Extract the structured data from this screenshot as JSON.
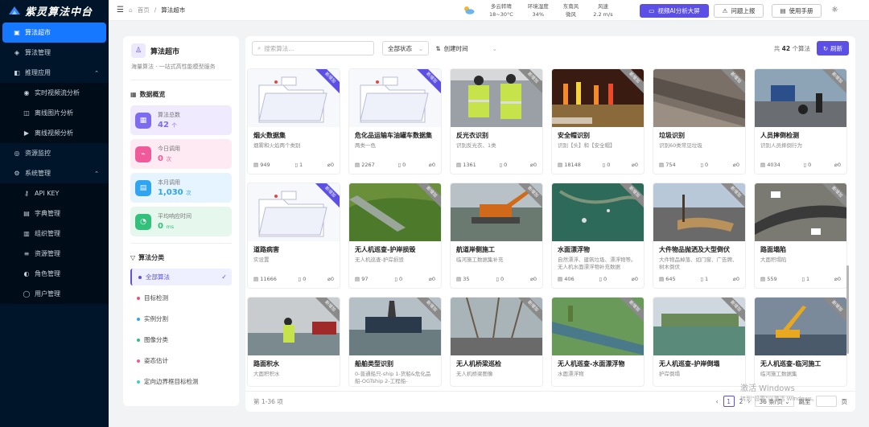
{
  "brand": {
    "name": "紫灵算法中台"
  },
  "sidebar": {
    "items": [
      {
        "label": "算法超市",
        "icon": "shop-icon",
        "active": true
      },
      {
        "label": "算法管理",
        "icon": "cube-icon"
      },
      {
        "label": "推理应用",
        "icon": "app-icon",
        "group": true
      },
      {
        "label": "实时视频流分析",
        "icon": "video-icon",
        "sub": true
      },
      {
        "label": "离线图片分析",
        "icon": "image-icon",
        "sub": true
      },
      {
        "label": "离线视频分析",
        "icon": "film-icon",
        "sub": true
      },
      {
        "label": "资源监控",
        "icon": "monitor-icon"
      },
      {
        "label": "系统管理",
        "icon": "gear-icon",
        "group": true
      },
      {
        "label": "API KEY",
        "icon": "key-icon",
        "sub": true
      },
      {
        "label": "字典管理",
        "icon": "book-icon",
        "sub": true
      },
      {
        "label": "组织管理",
        "icon": "org-icon",
        "sub": true
      },
      {
        "label": "资源管理",
        "icon": "list-icon",
        "sub": true
      },
      {
        "label": "角色管理",
        "icon": "role-icon",
        "sub": true
      },
      {
        "label": "用户管理",
        "icon": "user-icon",
        "sub": true
      }
    ]
  },
  "topbar": {
    "breadcrumb": {
      "home": "首页",
      "sep": "/",
      "current": "算法超市"
    },
    "weather": [
      {
        "l1": "多云转晴",
        "l2": "18~30°C"
      },
      {
        "l1": "环境湿度",
        "l2": "34%"
      },
      {
        "l1": "东南风",
        "l2": "微风"
      },
      {
        "l1": "风速",
        "l2": "2.2 m/s"
      }
    ],
    "big_screen_btn": "视频AI分析大屏",
    "report_btn": "问题上报",
    "manual_btn": "使用手册"
  },
  "left_panel": {
    "title": "算法超市",
    "subtitle": "海量算法 · 一站式高性能模型服务",
    "overview_title": "数据概览",
    "stats": [
      {
        "label": "算法总数",
        "value": "42",
        "unit": "个",
        "color": "#7d6cf0",
        "bg": "#efeafe"
      },
      {
        "label": "今日调用",
        "value": "0",
        "unit": "次",
        "color": "#f05a9a",
        "bg": "#fdeaf3"
      },
      {
        "label": "本月调用",
        "value": "1,030",
        "unit": "次",
        "color": "#2fa4f0",
        "bg": "#e5f4fe"
      },
      {
        "label": "平均响应时间",
        "value": "0",
        "unit": "ms",
        "color": "#32c07a",
        "bg": "#e6f8ee"
      }
    ],
    "category_title": "算法分类",
    "categories": [
      {
        "label": "全部算法",
        "color": "#5b4fe6",
        "active": true
      },
      {
        "label": "目标检测",
        "color": "#f0506e"
      },
      {
        "label": "实例分割",
        "color": "#2fa4f0"
      },
      {
        "label": "图像分类",
        "color": "#32c07a"
      },
      {
        "label": "姿态估计",
        "color": "#f05a9a"
      },
      {
        "label": "定向边界框目标检测",
        "color": "#3ccfcf"
      }
    ]
  },
  "toolbar": {
    "search_placeholder": "搜索算法...",
    "status_select": "全部状态",
    "sort_select": "创建时间",
    "count_prefix": "共",
    "count": "42",
    "count_suffix": "个算法",
    "refresh": "刷新"
  },
  "cards": [
    {
      "name": "烟火数据集",
      "desc": "烟雾和火焰两个类别",
      "views": "949",
      "a": "1",
      "b": "0",
      "img": "folder",
      "ribbon": "新增加"
    },
    {
      "name": "危化品运输车油罐车数据集",
      "desc": "两类一色",
      "views": "2267",
      "a": "0",
      "b": "0",
      "img": "folder",
      "ribbon": "新增加"
    },
    {
      "name": "反光衣识别",
      "desc": "识别反光衣、1类",
      "views": "1361",
      "a": "0",
      "b": "0",
      "img": "vest",
      "ribbon": "新增加"
    },
    {
      "name": "安全帽识别",
      "desc": "识别【头】和【安全帽】",
      "views": "18148",
      "a": "0",
      "b": "0",
      "img": "night",
      "ribbon": "新增加"
    },
    {
      "name": "垃圾识别",
      "desc": "识别60类常见垃圾",
      "views": "754",
      "a": "0",
      "b": "0",
      "img": "tracks",
      "ribbon": "新增加"
    },
    {
      "name": "人员摔倒检测",
      "desc": "识别人员摔倒行为",
      "views": "4034",
      "a": "0",
      "b": "0",
      "img": "street",
      "ribbon": "新增加"
    },
    {
      "name": "道路病害",
      "desc": "实设置",
      "views": "11666",
      "a": "0",
      "b": "0",
      "img": "folder",
      "ribbon": "新增加"
    },
    {
      "name": "无人机巡查-护岸损毁",
      "desc": "无人机巡查-护岸损毁",
      "views": "97",
      "a": "0",
      "b": "0",
      "img": "green",
      "ribbon": "新增加"
    },
    {
      "name": "航道岸侧施工",
      "desc": "临河施工数据集补充",
      "views": "35",
      "a": "0",
      "b": "0",
      "img": "dredger",
      "ribbon": "新增加"
    },
    {
      "name": "水面漂浮物",
      "desc": "自然漂浮、建筑垃圾、漂浮物等。无人机水面漂浮物补充数据",
      "views": "406",
      "a": "0",
      "b": "0",
      "img": "water",
      "ribbon": "新增加"
    },
    {
      "name": "大件物品抛洒及大型倒伏",
      "desc": "大件物品掉落、如门窗、广告牌、树木倒伏",
      "views": "645",
      "a": "1",
      "b": "0",
      "img": "road",
      "ribbon": "新增加"
    },
    {
      "name": "路面塌陷",
      "desc": "大面积塌陷",
      "views": "559",
      "a": "1",
      "b": "0",
      "img": "aerial",
      "ribbon": "新增加"
    },
    {
      "name": "路面积水",
      "desc": "大面积积水",
      "views": "",
      "a": "",
      "b": "",
      "img": "flood",
      "ribbon": "新增加"
    },
    {
      "name": "船舶类型识别",
      "desc": "0-普通船只-ship 1-货船&危化品船-OGTship 2-工程船-",
      "views": "",
      "a": "",
      "b": "",
      "img": "ship",
      "ribbon": "新增加"
    },
    {
      "name": "无人机桥梁巡检",
      "desc": "无人机桥梁图像",
      "views": "",
      "a": "",
      "b": "",
      "img": "bridge",
      "ribbon": "新增加"
    },
    {
      "name": "无人机巡查-水面漂浮物",
      "desc": "水面漂浮物",
      "views": "",
      "a": "",
      "b": "",
      "img": "river",
      "ribbon": "新增加"
    },
    {
      "name": "无人机巡查-护岸倒塌",
      "desc": "护岸倒塌",
      "views": "",
      "a": "",
      "b": "",
      "img": "bank",
      "ribbon": "新增加"
    },
    {
      "name": "无人机巡查-临河施工",
      "desc": "临河施工数据集",
      "views": "",
      "a": "",
      "b": "",
      "img": "crane",
      "ribbon": "新增加"
    }
  ],
  "pager": {
    "range": "第 1-36 项",
    "page1": "1",
    "page2": "2",
    "page_size": "36 条/页",
    "jump_label": "跳至",
    "page_unit": "页"
  },
  "watermark": {
    "l1": "激活 Windows",
    "l2": "转到\"设置\"以激活 Windows。"
  },
  "colors": {
    "accent": "#5b4fe6",
    "sidebar_bg": "#001529",
    "active_nav": "#1677ff"
  }
}
